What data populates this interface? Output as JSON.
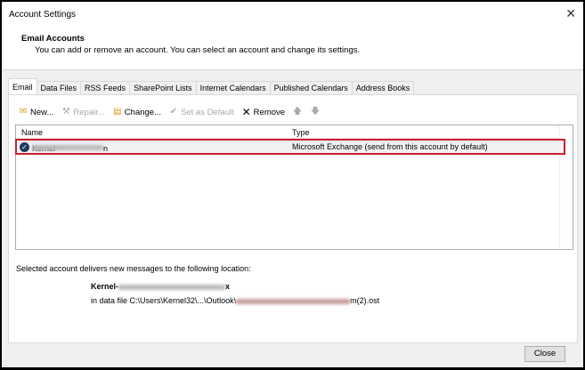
{
  "window": {
    "title": "Account Settings",
    "close_icon": "close-icon"
  },
  "header": {
    "title": "Email Accounts",
    "description": "You can add or remove an account. You can select an account and change its settings."
  },
  "tabs": [
    {
      "label": "Email",
      "active": true
    },
    {
      "label": "Data Files"
    },
    {
      "label": "RSS Feeds"
    },
    {
      "label": "SharePoint Lists"
    },
    {
      "label": "Internet Calendars"
    },
    {
      "label": "Published Calendars"
    },
    {
      "label": "Address Books"
    }
  ],
  "toolbar": {
    "new": "New...",
    "repair": "Repair...",
    "change": "Change...",
    "set_default": "Set as Default",
    "remove": "Remove"
  },
  "list": {
    "columns": [
      "Name",
      "Type"
    ],
    "rows": [
      {
        "name_prefix": "Kernel-",
        "name_suffix": "n",
        "type": "Microsoft Exchange (send from this account by default)",
        "selected": true
      }
    ]
  },
  "location": {
    "label": "Selected account delivers new messages to the following location:",
    "account_prefix": "Kernel-",
    "account_suffix": "x",
    "file_prefix": "in data file C:\\Users\\Kernel32\\...\\Outlook\\",
    "file_suffix": "m(2).ost"
  },
  "footer": {
    "close": "Close"
  },
  "colors": {
    "selection_border": "#c8202f"
  }
}
